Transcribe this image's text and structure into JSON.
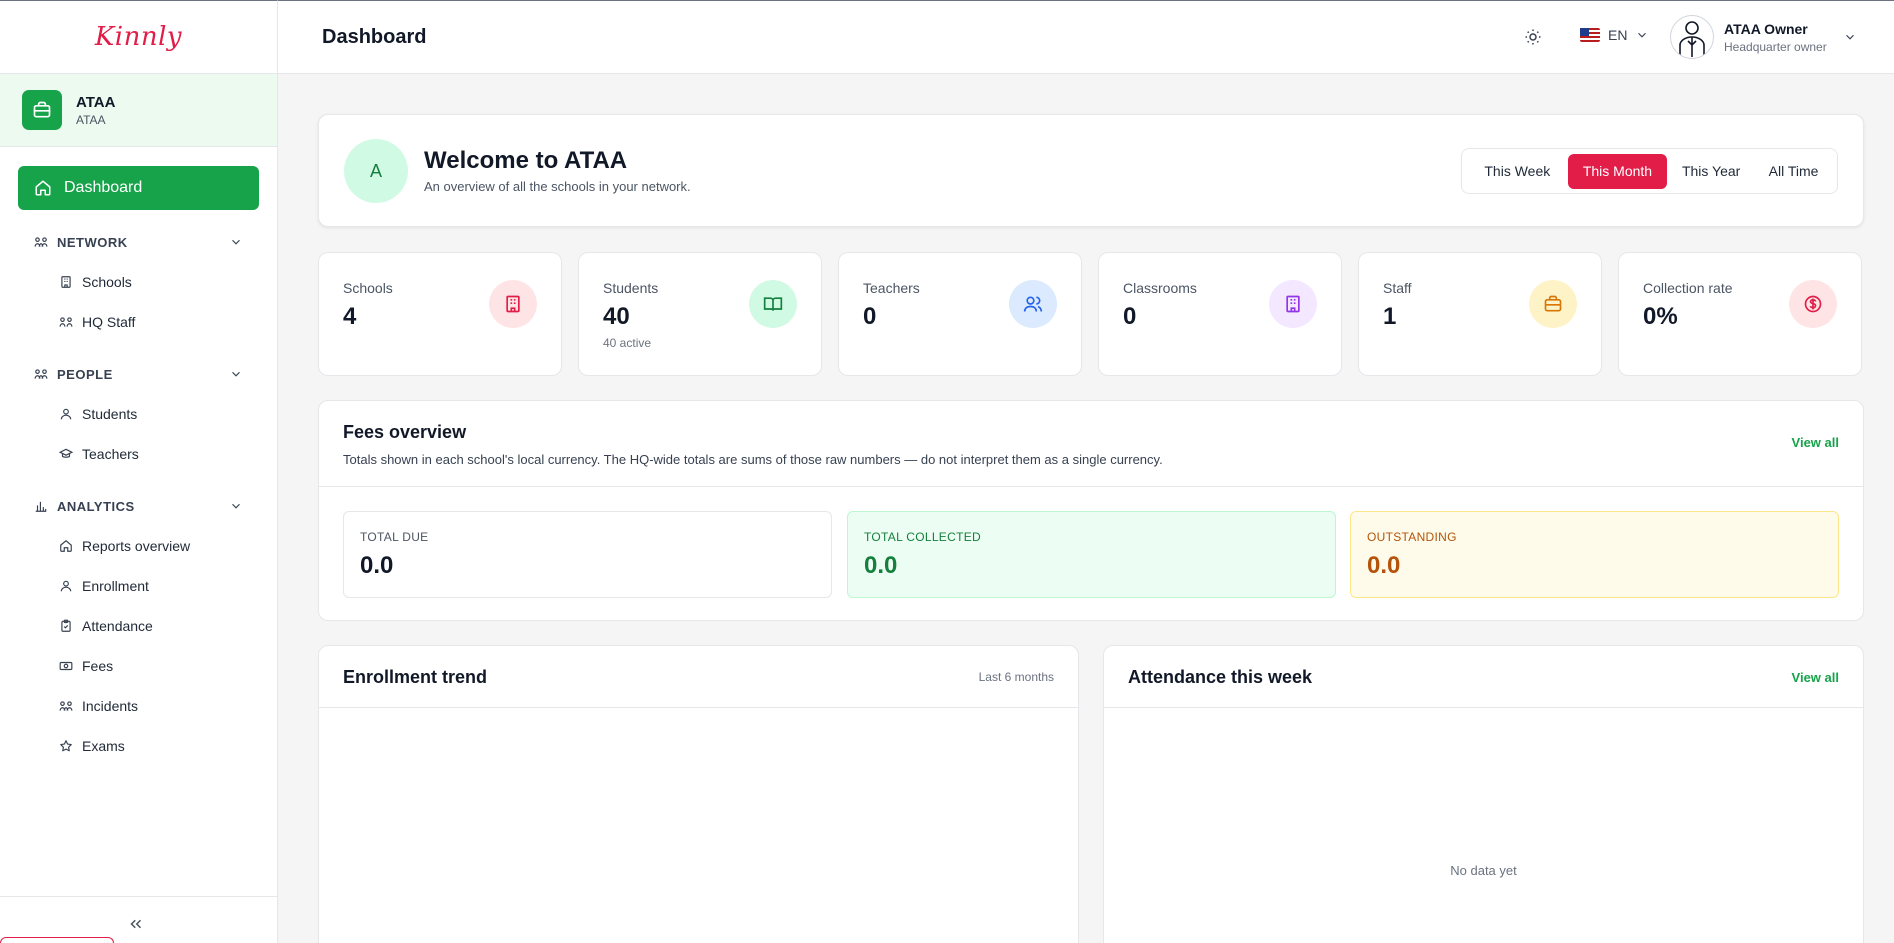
{
  "brand": {
    "logo_text": "Kinnly"
  },
  "org": {
    "name": "ATAA",
    "subtitle": "ATAA"
  },
  "sidebar": {
    "active": {
      "label": "Dashboard",
      "icon": "home-icon"
    },
    "sections": [
      {
        "title": "NETWORK",
        "icon": "network-icon",
        "items": [
          {
            "label": "Schools",
            "icon": "building-icon"
          },
          {
            "label": "HQ Staff",
            "icon": "staff-icon"
          }
        ]
      },
      {
        "title": "PEOPLE",
        "icon": "people-icon",
        "items": [
          {
            "label": "Students",
            "icon": "user-icon"
          },
          {
            "label": "Teachers",
            "icon": "graduation-cap-icon"
          }
        ]
      },
      {
        "title": "ANALYTICS",
        "icon": "bar-chart-icon",
        "items": [
          {
            "label": "Reports overview",
            "icon": "home-icon"
          },
          {
            "label": "Enrollment",
            "icon": "user-icon"
          },
          {
            "label": "Attendance",
            "icon": "clipboard-icon"
          },
          {
            "label": "Fees",
            "icon": "banknote-icon"
          },
          {
            "label": "Incidents",
            "icon": "alert-icon"
          },
          {
            "label": "Exams",
            "icon": "star-icon"
          }
        ]
      }
    ]
  },
  "header": {
    "title": "Dashboard",
    "language": "EN",
    "user": {
      "name": "ATAA Owner",
      "role": "Headquarter owner"
    }
  },
  "welcome": {
    "initial": "A",
    "title": "Welcome to ATAA",
    "subtitle": "An overview of all the schools in your network.",
    "periods": [
      "This Week",
      "This Month",
      "This Year",
      "All Time"
    ],
    "active_period": "This Month"
  },
  "stats": [
    {
      "label": "Schools",
      "value": "4",
      "sub": "",
      "icon": "building-icon",
      "color": "#e11d48",
      "bg": "#ffe4e6"
    },
    {
      "label": "Students",
      "value": "40",
      "sub": "40 active",
      "icon": "book-open-icon",
      "color": "#15803d",
      "bg": "#d1fae5"
    },
    {
      "label": "Teachers",
      "value": "0",
      "sub": "",
      "icon": "users-icon",
      "color": "#2563eb",
      "bg": "#dbeafe"
    },
    {
      "label": "Classrooms",
      "value": "0",
      "sub": "",
      "icon": "building-icon",
      "color": "#9333ea",
      "bg": "#f3e8ff"
    },
    {
      "label": "Staff",
      "value": "1",
      "sub": "",
      "icon": "briefcase-icon",
      "color": "#d97706",
      "bg": "#fef3c7"
    },
    {
      "label": "Collection rate",
      "value": "0%",
      "sub": "",
      "icon": "dollar-circle-icon",
      "color": "#e11d48",
      "bg": "#ffe4e6"
    }
  ],
  "fees": {
    "title": "Fees overview",
    "note": "Totals shown in each school's local currency. The HQ-wide totals are sums of those raw numbers — do not interpret them as a single currency.",
    "view_all": "View all",
    "boxes": [
      {
        "label": "TOTAL DUE",
        "value": "0.0"
      },
      {
        "label": "TOTAL COLLECTED",
        "value": "0.0"
      },
      {
        "label": "OUTSTANDING",
        "value": "0.0"
      }
    ]
  },
  "enrollment": {
    "title": "Enrollment trend",
    "meta": "Last 6 months"
  },
  "attendance": {
    "title": "Attendance this week",
    "view_all": "View all",
    "empty": "No data yet"
  },
  "colors": {
    "brand": "#e11d48",
    "accent": "#16a34a"
  }
}
